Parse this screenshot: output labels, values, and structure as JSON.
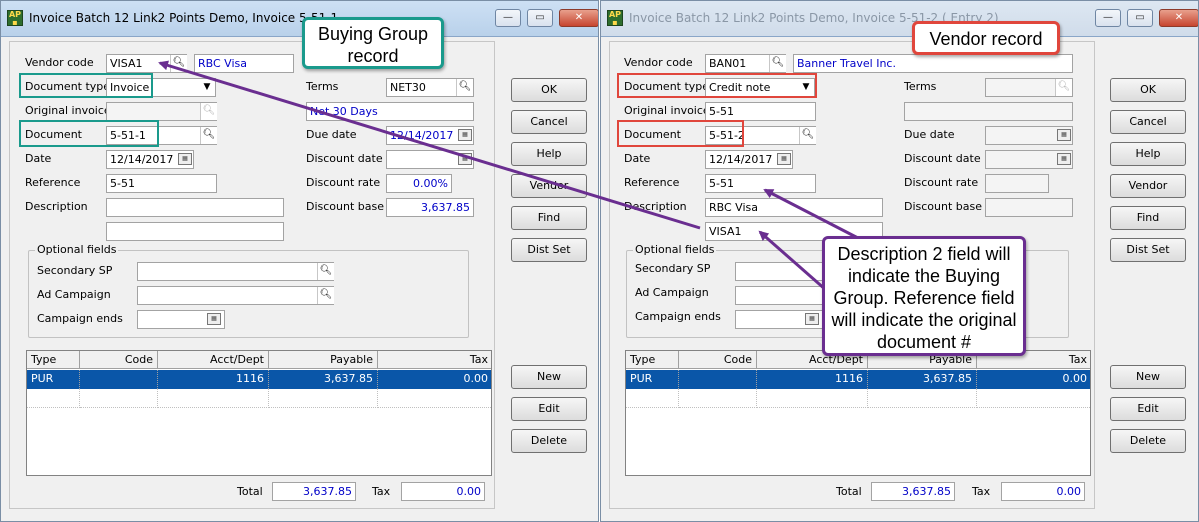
{
  "left": {
    "title": "Invoice Batch 12 Link2 Points Demo,  Invoice 5-51-1",
    "window_controls": {
      "minimize": "—",
      "maximize": "▭",
      "close": "✕"
    },
    "labels": {
      "vendor_code": "Vendor code",
      "document_type": "Document type",
      "original_invoice": "Original invoice",
      "document": "Document",
      "date": "Date",
      "reference": "Reference",
      "description": "Description",
      "terms": "Terms",
      "due_date": "Due date",
      "discount_date": "Discount date",
      "discount_rate": "Discount rate",
      "discount_base": "Discount base"
    },
    "values": {
      "vendor_code": "VISA1",
      "vendor_name": "RBC Visa",
      "document_type": "Invoice",
      "original_invoice": "",
      "document": "5-51-1",
      "date": "12/14/2017",
      "reference": "5-51",
      "description1": "",
      "description2": "",
      "terms": "NET30",
      "terms_desc": "Net 30 Days",
      "due_date": "12/14/2017",
      "discount_date": "",
      "discount_rate": "0.00%",
      "discount_base": "3,637.85"
    },
    "optional": {
      "title": "Optional fields",
      "secondary_sp": "Secondary SP",
      "ad_campaign": "Ad Campaign",
      "campaign_ends": "Campaign ends",
      "secondary_sp_value": "",
      "ad_campaign_value": "",
      "campaign_ends_value": ""
    },
    "buttons": {
      "ok": "OK",
      "cancel": "Cancel",
      "help": "Help",
      "vendor": "Vendor",
      "find": "Find",
      "dist_set": "Dist Set",
      "new": "New",
      "edit": "Edit",
      "delete": "Delete"
    },
    "grid": {
      "headers": [
        "Type",
        "Code",
        "Acct/Dept",
        "Payable",
        "Tax"
      ],
      "rows": [
        [
          "PUR",
          "",
          "1116",
          "3,637.85",
          "0.00"
        ]
      ]
    },
    "totals": {
      "total_label": "Total",
      "total": "3,637.85",
      "tax_label": "Tax",
      "tax": "0.00"
    }
  },
  "right": {
    "title": "Invoice Batch 12 Link2 Points Demo,  Invoice 5-51-2 ( Entry 2)",
    "window_controls": {
      "minimize": "—",
      "maximize": "▭",
      "close": "✕"
    },
    "labels": {
      "vendor_code": "Vendor code",
      "document_type": "Document type",
      "original_invoice": "Original invoice",
      "document": "Document",
      "date": "Date",
      "reference": "Reference",
      "description": "Description",
      "terms": "Terms",
      "due_date": "Due date",
      "discount_date": "Discount date",
      "discount_rate": "Discount rate",
      "discount_base": "Discount base"
    },
    "values": {
      "vendor_code": "BAN01",
      "vendor_name": "Banner Travel Inc.",
      "document_type": "Credit note",
      "original_invoice": "5-51",
      "document": "5-51-2",
      "date": "12/14/2017",
      "reference": "5-51",
      "description1": "RBC Visa",
      "description2": "VISA1",
      "terms": "",
      "terms_desc": "",
      "due_date": "",
      "discount_date": "",
      "discount_rate": "",
      "discount_base": ""
    },
    "optional": {
      "title": "Optional fields",
      "secondary_sp": "Secondary SP",
      "ad_campaign": "Ad Campaign",
      "campaign_ends": "Campaign ends",
      "secondary_sp_value": "",
      "ad_campaign_value": "",
      "campaign_ends_value": ""
    },
    "buttons": {
      "ok": "OK",
      "cancel": "Cancel",
      "help": "Help",
      "vendor": "Vendor",
      "find": "Find",
      "dist_set": "Dist Set",
      "new": "New",
      "edit": "Edit",
      "delete": "Delete"
    },
    "grid": {
      "headers": [
        "Type",
        "Code",
        "Acct/Dept",
        "Payable",
        "Tax"
      ],
      "rows": [
        [
          "PUR",
          "",
          "1116",
          "3,637.85",
          "0.00"
        ]
      ]
    },
    "totals": {
      "total_label": "Total",
      "total": "3,637.85",
      "tax_label": "Tax",
      "tax": "0.00"
    }
  },
  "callouts": {
    "buying_group": "Buying Group record",
    "vendor_record": "Vendor record",
    "description2": "Description 2 field will indicate the Buying Group. Reference field will indicate the original document #"
  },
  "colors": {
    "teal": "#1a9a8c",
    "red": "#e0463c",
    "purple": "#6a2e90",
    "selection": "#0a56a8",
    "blue_text": "#0000c8"
  }
}
